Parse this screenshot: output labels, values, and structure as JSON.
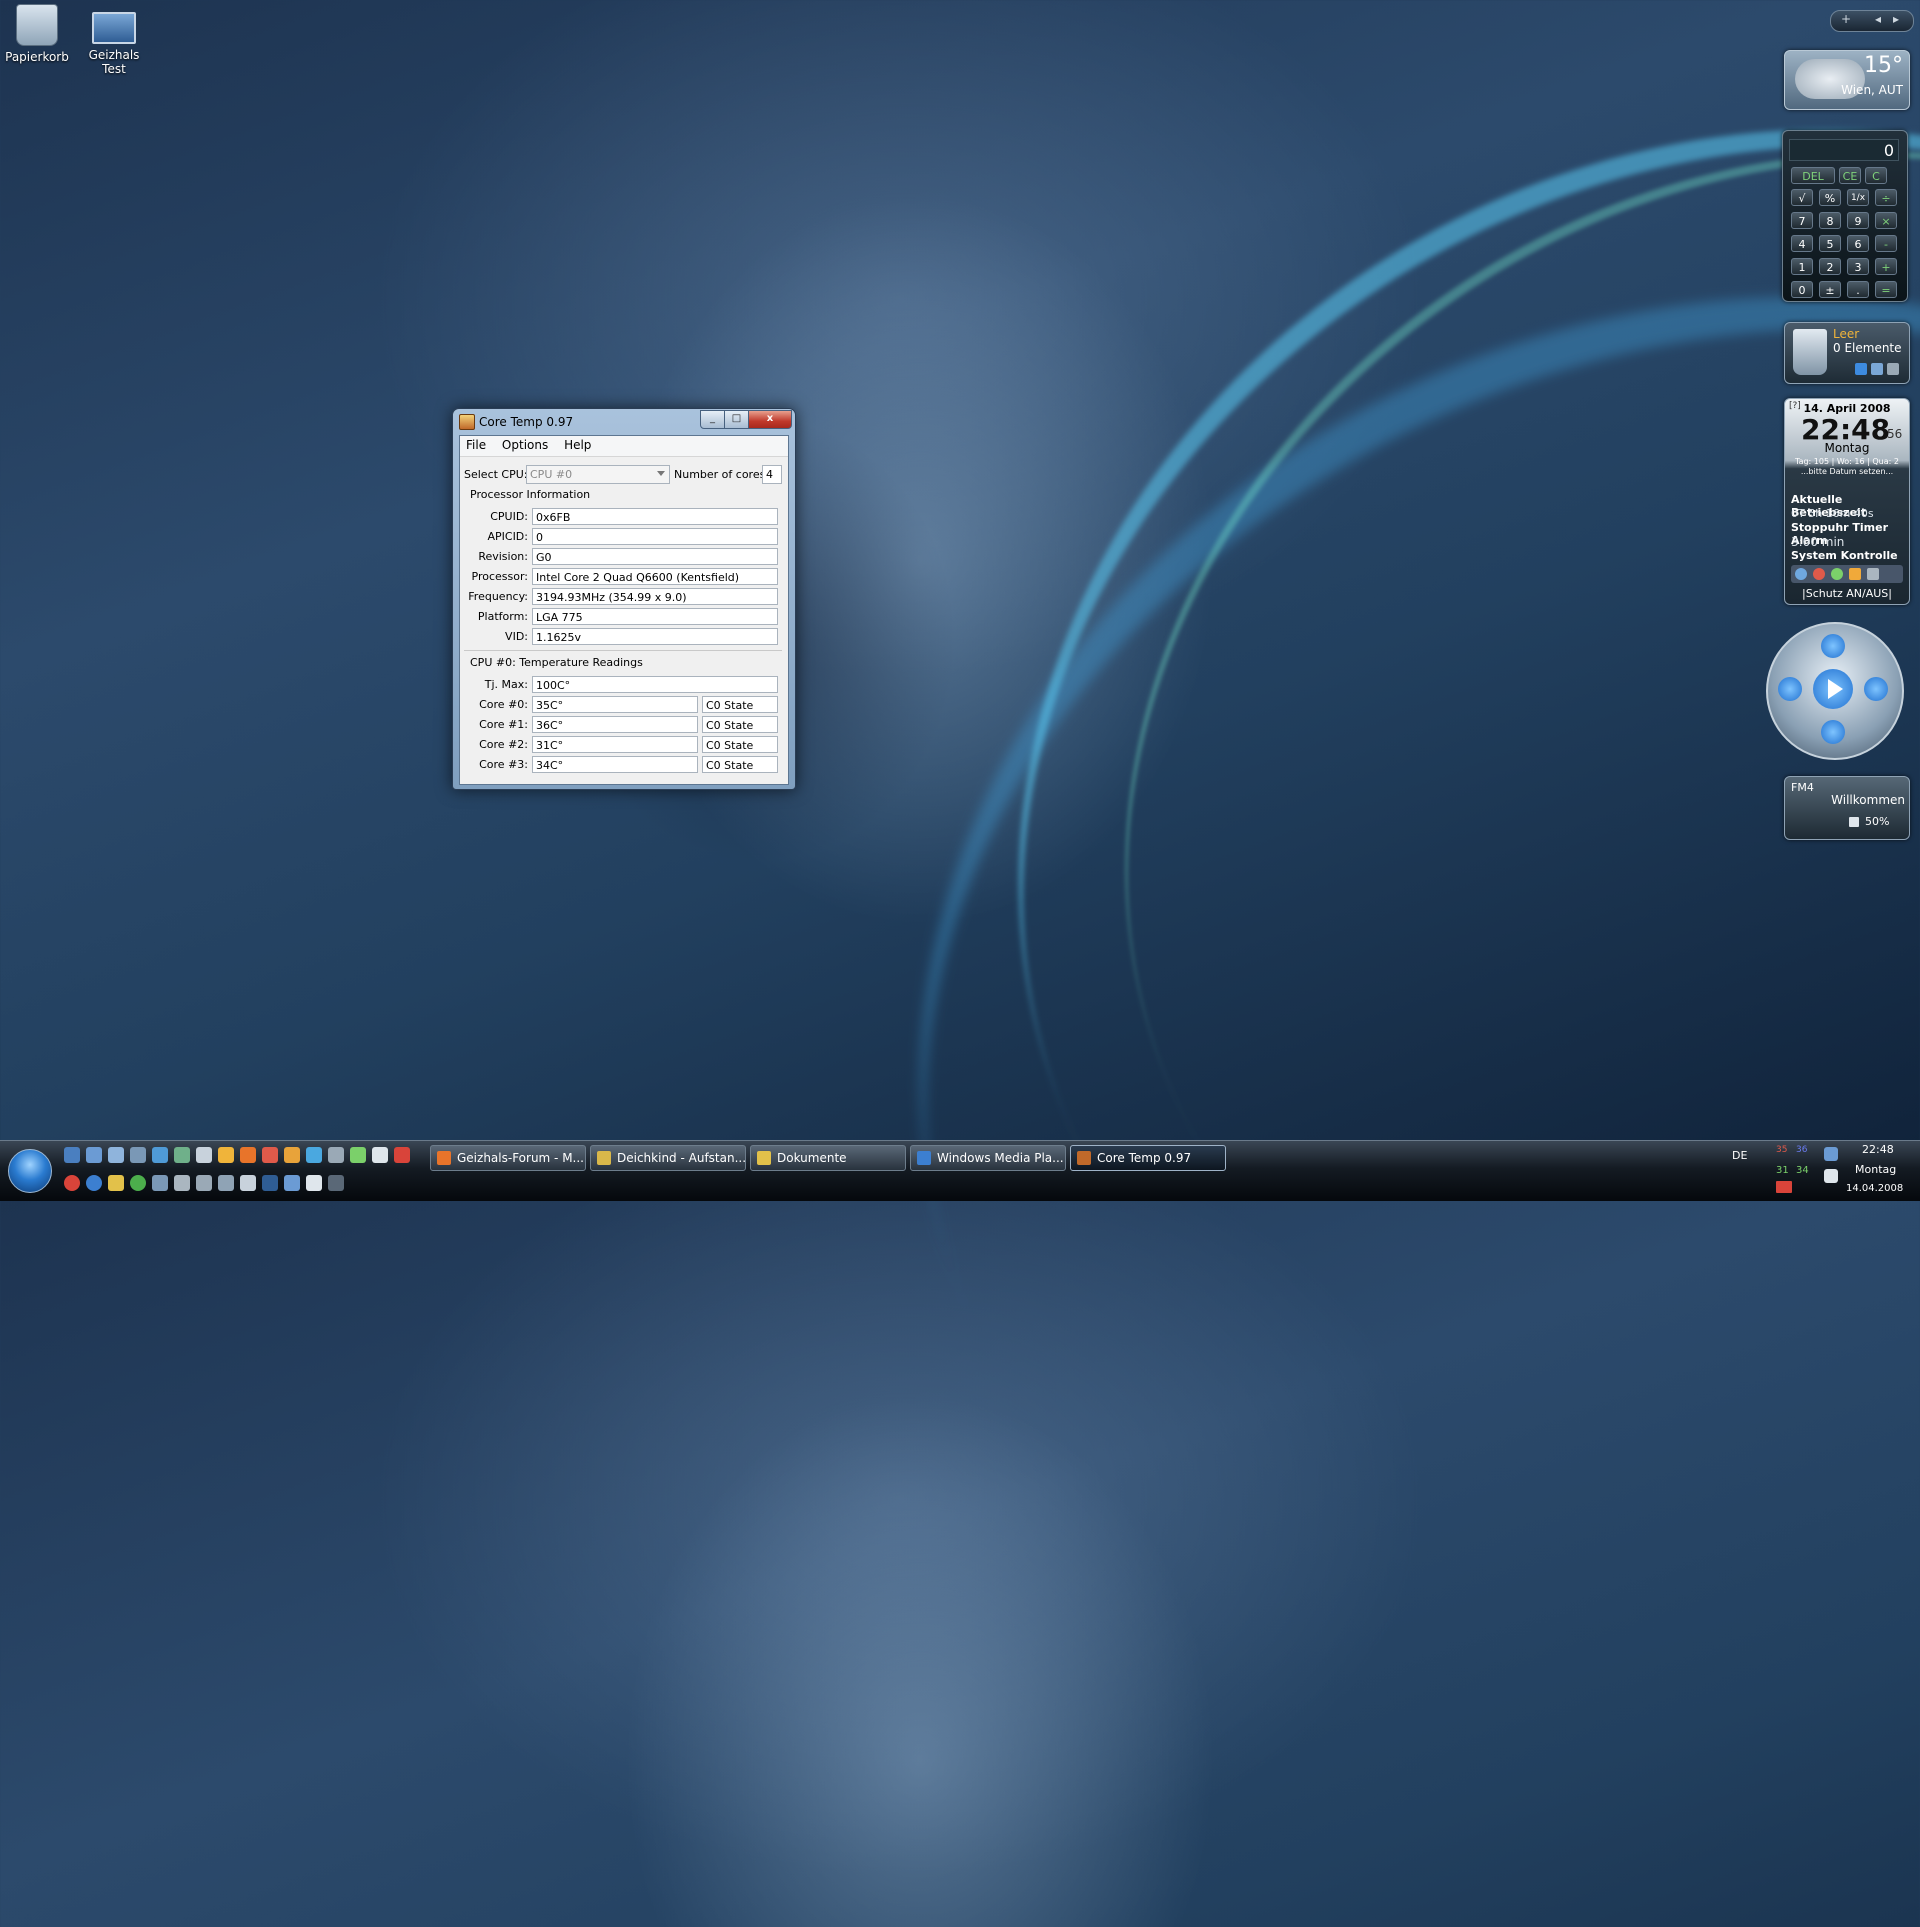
{
  "desktop": {
    "icons": [
      {
        "label": "Papierkorb"
      },
      {
        "label": "Geizhals Test"
      }
    ]
  },
  "window": {
    "title": "Core Temp 0.97",
    "close_glyph": "x",
    "min_glyph": "_",
    "max_glyph": "□",
    "menu": [
      "File",
      "Options",
      "Help"
    ],
    "select_cpu_label": "Select CPU:",
    "select_cpu_value": "CPU #0",
    "cores_label": "Number of cores",
    "cores_value": "4",
    "proc_group": "Processor Information",
    "proc_fields": [
      {
        "label": "CPUID:",
        "value": "0x6FB"
      },
      {
        "label": "APICID:",
        "value": "0"
      },
      {
        "label": "Revision:",
        "value": "G0"
      },
      {
        "label": "Processor:",
        "value": "Intel Core 2 Quad Q6600 (Kentsfield)"
      },
      {
        "label": "Frequency:",
        "value": "3194.93MHz (354.99 x 9.0)"
      },
      {
        "label": "Platform:",
        "value": "LGA 775"
      },
      {
        "label": "VID:",
        "value": "1.1625v"
      }
    ],
    "temp_group": "CPU #0: Temperature Readings",
    "tjmax_label": "Tj. Max:",
    "tjmax_value": "100C°",
    "cores": [
      {
        "label": "Core #0:",
        "temp": "35C°",
        "state": "C0 State"
      },
      {
        "label": "Core #1:",
        "temp": "36C°",
        "state": "C0 State"
      },
      {
        "label": "Core #2:",
        "temp": "31C°",
        "state": "C0 State"
      },
      {
        "label": "Core #3:",
        "temp": "34C°",
        "state": "C0 State"
      }
    ]
  },
  "gadgets": {
    "top_controls": {
      "add": "+",
      "prev": "◂",
      "next": "▸"
    },
    "weather": {
      "temp": "15°",
      "location": "Wien, AUT"
    },
    "calculator": {
      "display": "0",
      "keys": [
        [
          "DEL",
          "CE",
          "C"
        ],
        [
          "√",
          "%",
          "1/x",
          "÷"
        ],
        [
          "7",
          "8",
          "9",
          "×"
        ],
        [
          "4",
          "5",
          "6",
          "-"
        ],
        [
          "1",
          "2",
          "3",
          "+"
        ],
        [
          "0",
          "±",
          ".",
          "="
        ]
      ]
    },
    "recycle": {
      "status": "Leer",
      "count": "0 Elemente"
    },
    "clock": {
      "help": "[?]",
      "date": "14. April 2008",
      "time": "22:48",
      "seconds": "56",
      "weekday": "Montag",
      "info1": "Tag: 105 | Wo: 16 | Qua: 2",
      "info2": "...bitte Datum setzen...",
      "uptime_label": "Aktuelle Betriebszeit",
      "uptime": "0T 5h 16m 40s",
      "timer_label": "Stoppuhr Timer Alarm",
      "timer": "3:00 min",
      "system_label": "System Kontrolle",
      "protect": "|Schutz AN/AUS|"
    },
    "radio": {
      "station": "FM4",
      "message": "Willkommen",
      "volume": "50%"
    }
  },
  "taskbar": {
    "tasks": [
      {
        "label": "Geizhals-Forum - M...",
        "color": "#e8742a"
      },
      {
        "label": "Deichkind - Aufstan...",
        "color": "#d9b84a"
      },
      {
        "label": "Dokumente",
        "color": "#e2c14a"
      },
      {
        "label": "Windows Media Pla...",
        "color": "#3c7fd0"
      },
      {
        "label": "Core Temp 0.97",
        "color": "#c0692a"
      }
    ],
    "language": "DE",
    "cpu_temps_top": [
      "35",
      "36"
    ],
    "cpu_temps_bottom": [
      "31",
      "34"
    ],
    "time": "22:48",
    "day": "Montag",
    "date": "14.04.2008"
  }
}
